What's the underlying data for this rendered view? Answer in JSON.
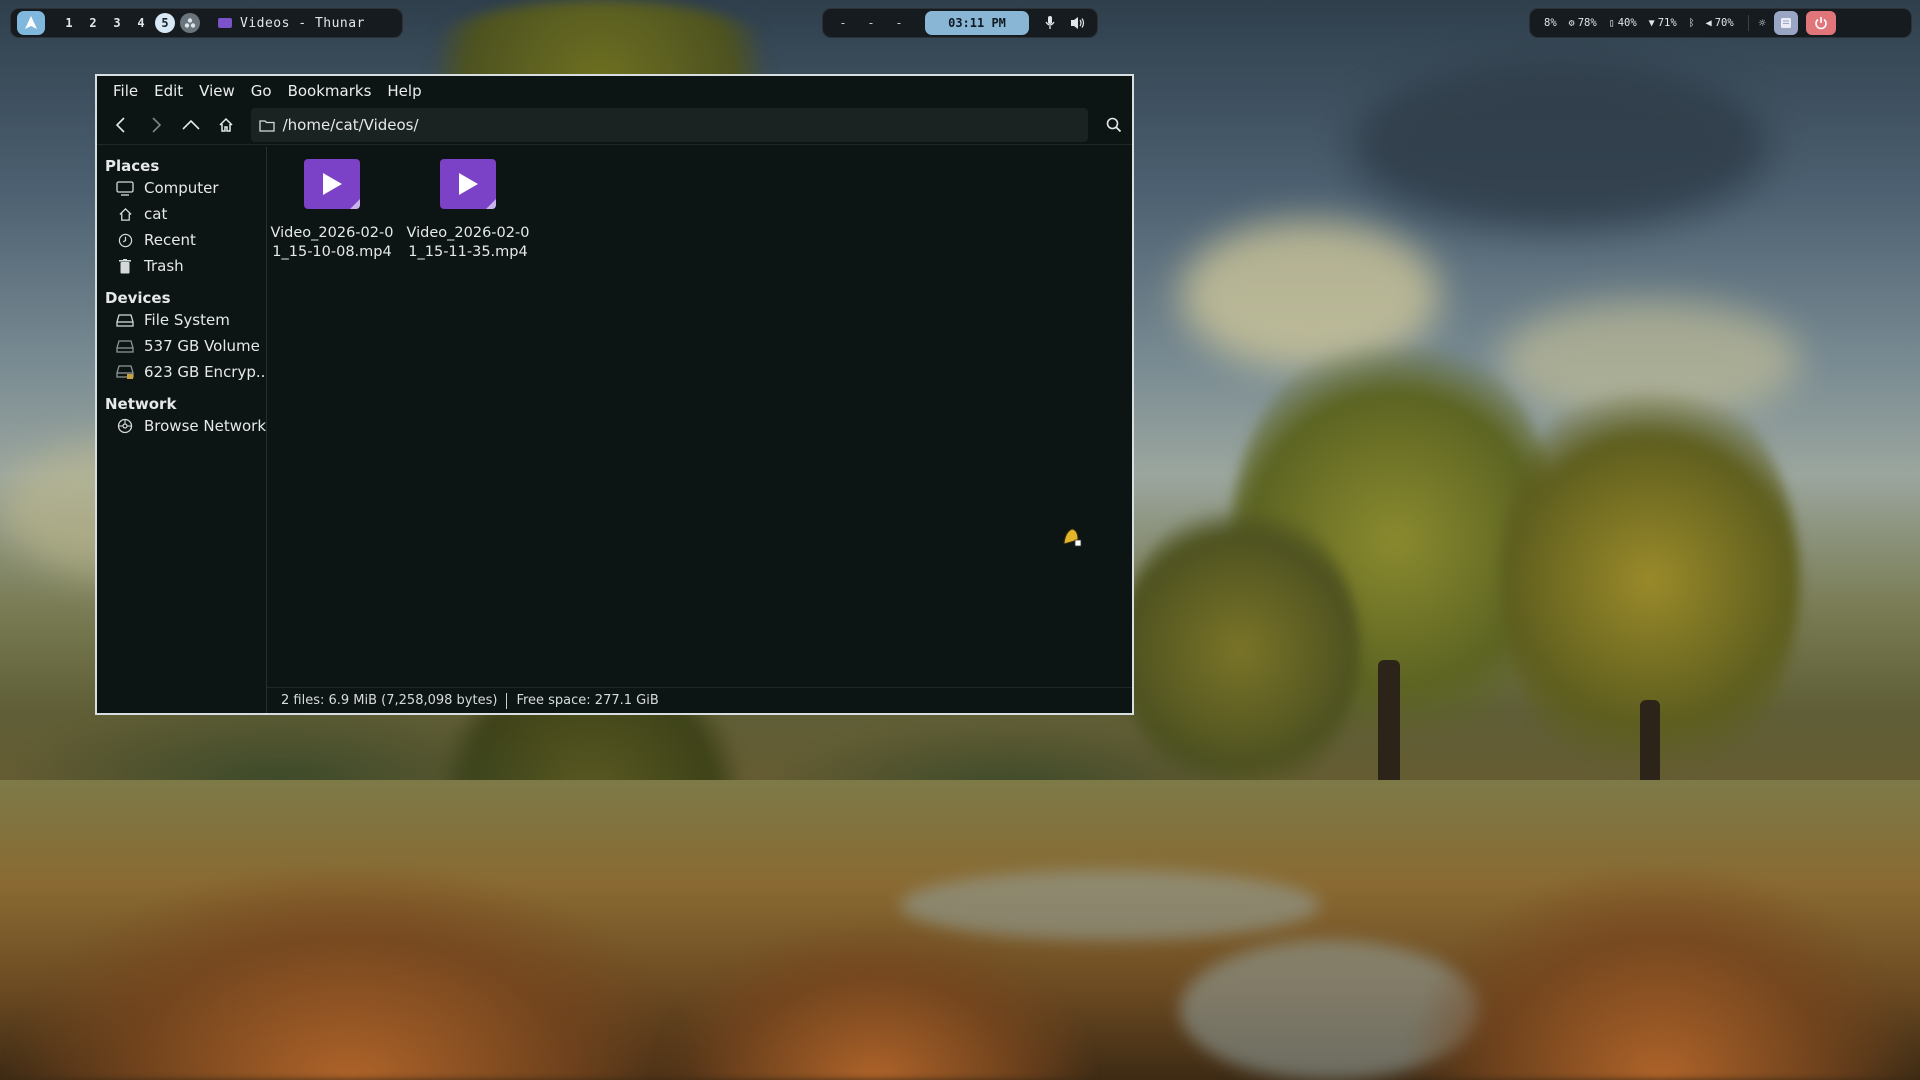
{
  "desktop": {
    "topbar": {
      "workspaces": [
        "1",
        "2",
        "3",
        "4",
        "5"
      ],
      "active_workspace": "5",
      "active_window_title": "Videos - Thunar",
      "center_dashes": [
        "-",
        "-",
        "-"
      ],
      "clock": "03:11 PM",
      "stats": {
        "cpu": "8%",
        "memory": "78%",
        "storage": "40%",
        "wifi": "71%",
        "volume": "70%"
      },
      "icons": {
        "launcher": "arch-launcher-icon",
        "mic": "microphone-icon",
        "speaker": "speaker-icon",
        "notifications": "notification-icon",
        "power": "power-icon"
      }
    }
  },
  "window": {
    "title": "Videos - Thunar",
    "menu": [
      "File",
      "Edit",
      "View",
      "Go",
      "Bookmarks",
      "Help"
    ],
    "location": "/home/cat/Videos/",
    "sidebar": {
      "places": {
        "title": "Places",
        "items": [
          "Computer",
          "cat",
          "Recent",
          "Trash"
        ]
      },
      "devices": {
        "title": "Devices",
        "items": [
          "File System",
          "537 GB Volume",
          "623 GB Encryp..."
        ]
      },
      "network": {
        "title": "Network",
        "items": [
          "Browse Network"
        ]
      }
    },
    "files": [
      {
        "name": "Video_2026-02-01_15-10-08.mp4",
        "icon": "video-file-icon"
      },
      {
        "name": "Video_2026-02-01_15-11-35.mp4",
        "icon": "video-file-icon"
      }
    ],
    "status": {
      "files_summary": "2 files: 6.9 MiB (7,258,098 bytes)",
      "free_space": "Free space: 277.1 GiB"
    }
  },
  "colors": {
    "window_bg": "#0c1414",
    "accent": "#8ab6d6",
    "video_icon": "#7b41c6",
    "power": "#e0767a"
  }
}
